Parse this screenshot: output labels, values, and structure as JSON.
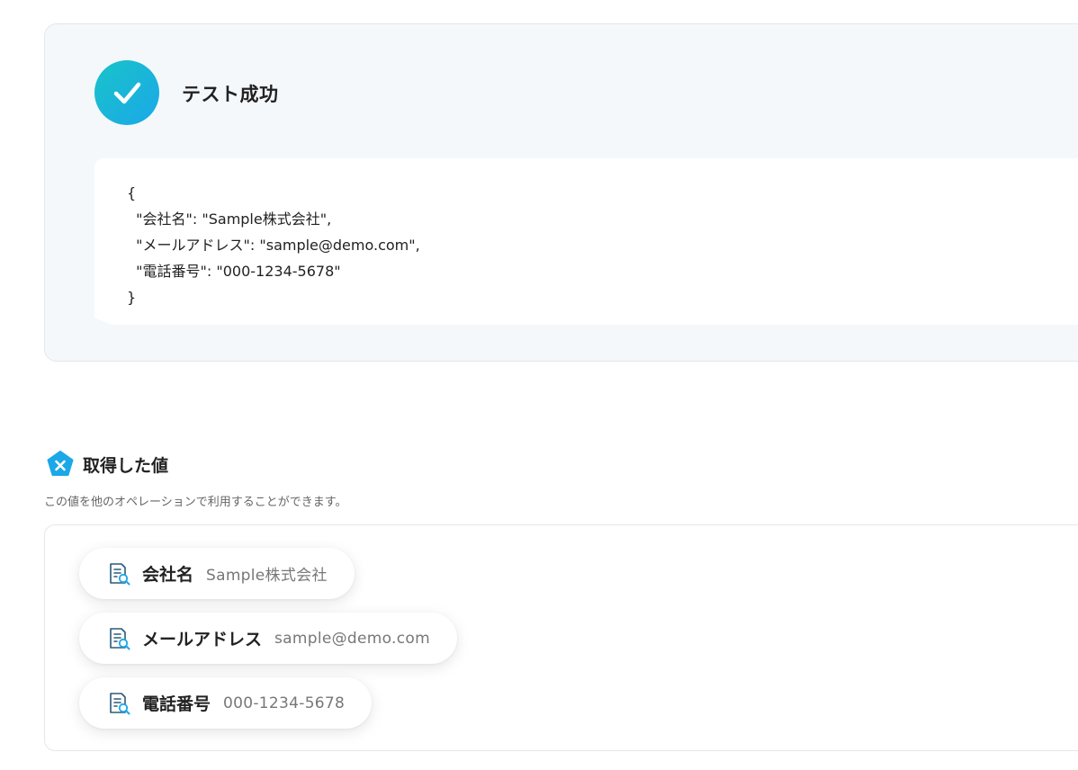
{
  "result": {
    "title": "テスト成功",
    "json_output": "{\n  \"会社名\": \"Sample株式会社\",\n  \"メールアドレス\": \"sample@demo.com\",\n  \"電話番号\": \"000-1234-5678\"\n}"
  },
  "acquired": {
    "title": "取得した値",
    "description": "この値を他のオペレーションで利用することができます。",
    "items": [
      {
        "key": "会社名",
        "value": "Sample株式会社",
        "icon": "document-search-icon"
      },
      {
        "key": "メールアドレス",
        "value": "sample@demo.com",
        "icon": "document-search-icon"
      },
      {
        "key": "電話番号",
        "value": "000-1234-5678",
        "icon": "document-search-icon"
      }
    ]
  },
  "colors": {
    "success_gradient_start": "#19c3c9",
    "success_gradient_end": "#1aa8e8",
    "section_icon": "#1aa8e8",
    "card_background": "#f5f8fb"
  }
}
